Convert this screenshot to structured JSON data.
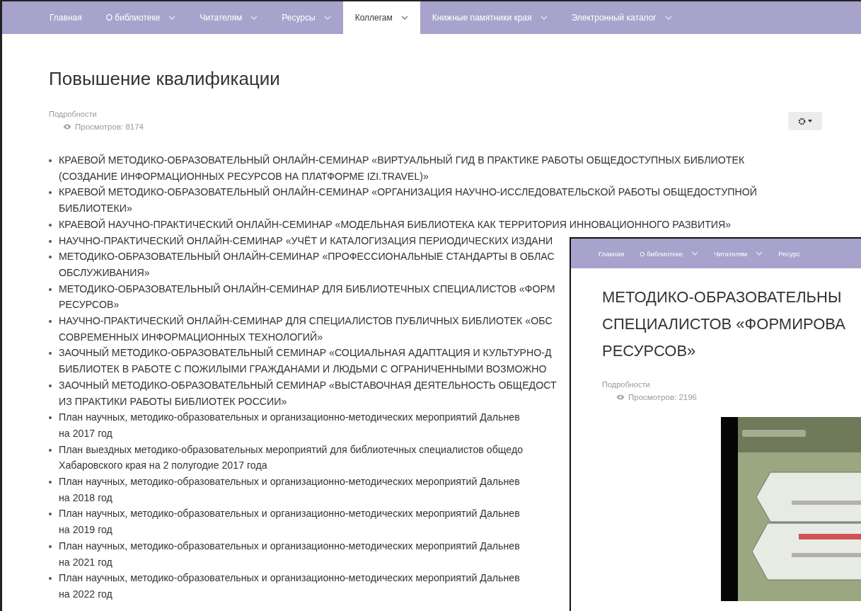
{
  "nav": {
    "items": [
      {
        "label": "Главная",
        "has_dropdown": false,
        "selected": false
      },
      {
        "label": "О библиотеке",
        "has_dropdown": true,
        "selected": false
      },
      {
        "label": "Читателям",
        "has_dropdown": true,
        "selected": false
      },
      {
        "label": "Ресурсы",
        "has_dropdown": true,
        "selected": false
      },
      {
        "label": "Коллегам",
        "has_dropdown": true,
        "selected": true
      },
      {
        "label": "Книжные памятники края",
        "has_dropdown": true,
        "selected": false
      },
      {
        "label": "Электронный каталог",
        "has_dropdown": true,
        "selected": false
      }
    ]
  },
  "article": {
    "title": "Повышение квалификации",
    "details_label": "Подробности",
    "views": "Просмотров: 8174",
    "items": [
      {
        "lines": [
          "КРАЕВОЙ МЕТОДИКО-ОБРАЗОВАТЕЛЬНЫЙ ОНЛАЙН-СЕМИНАР «ВИРТУАЛЬНЫЙ ГИД В ПРАКТИКЕ РАБОТЫ ОБЩЕДОСТУПНЫХ БИБЛИОТЕК",
          "(СОЗДАНИЕ ИНФОРМАЦИОННЫХ РЕСУРСОВ НА ПЛАТФОРМЕ IZI.TRAVEL)»"
        ]
      },
      {
        "lines": [
          "КРАЕВОЙ МЕТОДИКО-ОБРАЗОВАТЕЛЬНЫЙ ОНЛАЙН-СЕМИНАР «ОРГАНИЗАЦИЯ НАУЧНО-ИССЛЕДОВАТЕЛЬСКОЙ РАБОТЫ ОБЩЕДОСТУПНОЙ",
          "БИБЛИОТЕКИ»"
        ]
      },
      {
        "lines": [
          "КРАЕВОЙ НАУЧНО-ПРАКТИЧЕСКИЙ ОНЛАЙН-СЕМИНАР «МОДЕЛЬНАЯ БИБЛИОТЕКА КАК ТЕРРИТОРИЯ ИННОВАЦИОННОГО РАЗВИТИЯ»"
        ]
      },
      {
        "lines": [
          "НАУЧНО-ПРАКТИЧЕСКИЙ ОНЛАЙН-СЕМИНАР «УЧЁТ И КАТАЛОГИЗАЦИЯ ПЕРИОДИЧЕСКИХ ИЗДАНИ"
        ]
      },
      {
        "lines": [
          "МЕТОДИКО-ОБРАЗОВАТЕЛЬНЫЙ ОНЛАЙН-СЕМИНАР «ПРОФЕССИОНАЛЬНЫЕ СТАНДАРТЫ В ОБЛАС",
          "ОБСЛУЖИВАНИЯ»"
        ]
      },
      {
        "lines": [
          "МЕТОДИКО-ОБРАЗОВАТЕЛЬНЫЙ ОНЛАЙН-СЕМИНАР ДЛЯ БИБЛИОТЕЧНЫХ СПЕЦИАЛИСТОВ «ФОРМ",
          "РЕСУРСОВ»"
        ]
      },
      {
        "lines": [
          "НАУЧНО-ПРАКТИЧЕСКИЙ ОНЛАЙН-СЕМИНАР ДЛЯ СПЕЦИАЛИСТОВ ПУБЛИЧНЫХ БИБЛИОТЕК «ОБС",
          "СОВРЕМЕННЫХ ИНФОРМАЦИОННЫХ ТЕХНОЛОГИЙ»"
        ]
      },
      {
        "lines": [
          "ЗАОЧНЫЙ МЕТОДИКО-ОБРАЗОВАТЕЛЬНЫЙ СЕМИНАР «СОЦИАЛЬНАЯ АДАПТАЦИЯ И КУЛЬТУРНО-Д",
          "БИБЛИОТЕК В  РАБОТЕ С ПОЖИЛЫМИ ГРАЖДАНАМИ И ЛЮДЬМИ С ОГРАНИЧЕННЫМИ ВОЗМОЖНО"
        ]
      },
      {
        "lines": [
          "ЗАОЧНЫЙ МЕТОДИКО-ОБРАЗОВАТЕЛЬНЫЙ СЕМИНАР «ВЫСТАВОЧНАЯ ДЕЯТЕЛЬНОСТЬ ОБЩЕДОСТ",
          "ИЗ ПРАКТИКИ РАБОТЫ БИБЛИОТЕК РОССИИ»"
        ]
      },
      {
        "lines": [
          "План научных, методико-образовательных и организационно-методических мероприятий Дальнев",
          "на 2017 год"
        ]
      },
      {
        "lines": [
          "План выездных методико-образовательных мероприятий для библиотечных специалистов общедо",
          "Хабаровского края на 2 полугодие 2017 года"
        ]
      },
      {
        "lines": [
          "План научных, методико-образовательных и организационно-методических мероприятий Дальнев",
          "на 2018 год"
        ]
      },
      {
        "lines": [
          "План научных, методико-образовательных и организационно-методических мероприятий Дальнев",
          "на 2019 год"
        ]
      },
      {
        "lines": [
          "План научных, методико-образовательных и организационно-методических мероприятий Дальнев",
          "на 2021 год"
        ]
      },
      {
        "lines": [
          "План научных, методико-образовательных и организационно-методических мероприятий Дальнев",
          "на 2022 год"
        ]
      }
    ]
  },
  "inset_screenshot": {
    "nav": {
      "items": [
        {
          "label": "Главная",
          "has_dropdown": false,
          "selected": false
        },
        {
          "label": "О библиотеке",
          "has_dropdown": true,
          "selected": false
        },
        {
          "label": "Читателям",
          "has_dropdown": true,
          "selected": false
        },
        {
          "label": "Ресурс",
          "has_dropdown": false,
          "selected": false
        }
      ]
    },
    "title_lines": [
      "МЕТОДИКО-ОБРАЗОВАТЕЛЬНЫ",
      "СПЕЦИАЛИСТОВ «ФОРМИРОВА",
      "РЕСУРСОВ»"
    ],
    "details_label": "Подробности",
    "views": "Просмотров: 2196",
    "video": {
      "kind": "picture"
    }
  }
}
